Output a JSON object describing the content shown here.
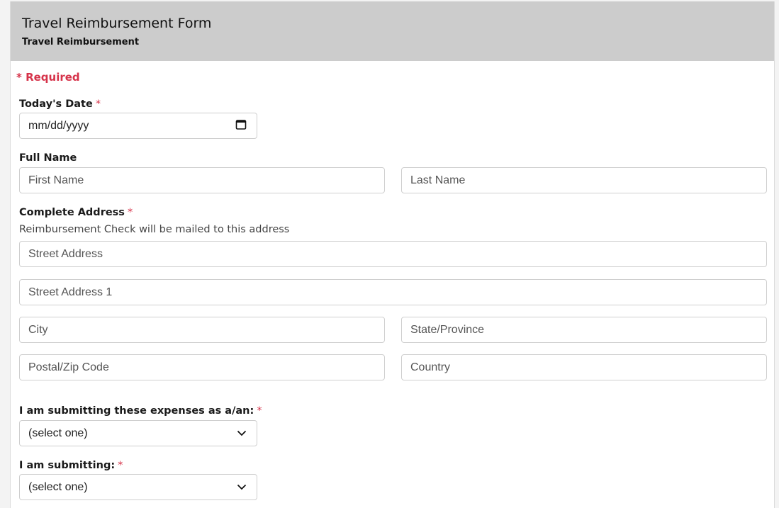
{
  "header": {
    "title": "Travel Reimbursement Form",
    "subtitle": "Travel Reimbursement"
  },
  "required_note": "* Required",
  "fields": {
    "date": {
      "label": "Today's Date",
      "required_mark": "*",
      "placeholder": "mm/dd/yyyy",
      "icon": "calendar-icon"
    },
    "full_name": {
      "label": "Full Name",
      "first_placeholder": "First Name",
      "last_placeholder": "Last Name"
    },
    "address": {
      "label": "Complete Address",
      "required_mark": "*",
      "help": "Reimbursement Check will be mailed to this address",
      "street_placeholder": "Street Address",
      "street1_placeholder": "Street Address 1",
      "city_placeholder": "City",
      "state_placeholder": "State/Province",
      "zip_placeholder": "Postal/Zip Code",
      "country_placeholder": "Country"
    },
    "submitting_as": {
      "label": "I am submitting these expenses as a/an:",
      "required_mark": "*",
      "selected": "(select one)",
      "icon": "chevron-down-icon"
    },
    "submitting": {
      "label": "I am submitting:",
      "required_mark": "*",
      "selected": "(select one)",
      "icon": "chevron-down-icon"
    }
  },
  "colors": {
    "header_bg": "#cccccc",
    "required": "#d6334a",
    "border": "#cfcfcf"
  }
}
